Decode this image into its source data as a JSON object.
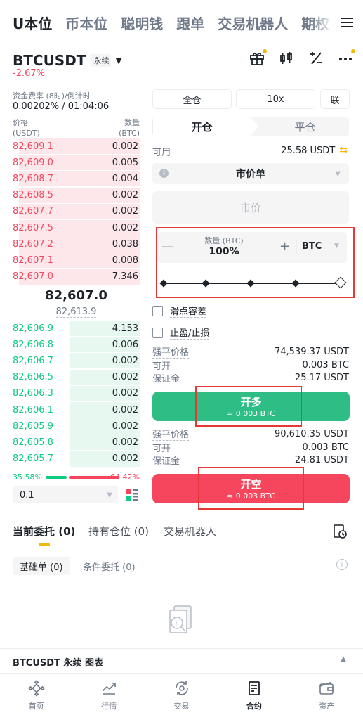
{
  "top_tabs": [
    "U本位",
    "币本位",
    "聪明钱",
    "跟单",
    "交易机器人",
    "期权"
  ],
  "header": {
    "symbol": "BTCUSDT",
    "perp_label": "永续",
    "change": "-2.67%"
  },
  "funding": {
    "label": "资金费率 (8时)/倒计时",
    "value": "0.00202% / 01:04:06"
  },
  "orderbook": {
    "price_label": "价格",
    "price_unit": "(USDT)",
    "qty_label": "数量",
    "qty_unit": "(BTC)",
    "asks": [
      {
        "price": "82,609.1",
        "qty": "0.002",
        "depth": 0.95
      },
      {
        "price": "82,609.0",
        "qty": "0.005",
        "depth": 0.95
      },
      {
        "price": "82,608.7",
        "qty": "0.004",
        "depth": 0.95
      },
      {
        "price": "82,608.5",
        "qty": "0.002",
        "depth": 0.95
      },
      {
        "price": "82,607.7",
        "qty": "0.002",
        "depth": 0.95
      },
      {
        "price": "82,607.5",
        "qty": "0.002",
        "depth": 0.95
      },
      {
        "price": "82,607.2",
        "qty": "0.038",
        "depth": 0.95
      },
      {
        "price": "82,607.1",
        "qty": "0.008",
        "depth": 0.95
      },
      {
        "price": "82,607.0",
        "qty": "7.346",
        "depth": 0.95
      }
    ],
    "last_price": "82,607.0",
    "mark_price": "82,613.9",
    "bids": [
      {
        "price": "82,606.9",
        "qty": "4.153",
        "depth": 0.55
      },
      {
        "price": "82,606.8",
        "qty": "0.006",
        "depth": 0.55
      },
      {
        "price": "82,606.7",
        "qty": "0.002",
        "depth": 0.55
      },
      {
        "price": "82,606.5",
        "qty": "0.002",
        "depth": 0.55
      },
      {
        "price": "82,606.3",
        "qty": "0.002",
        "depth": 0.55
      },
      {
        "price": "82,606.1",
        "qty": "0.002",
        "depth": 0.55
      },
      {
        "price": "82,605.9",
        "qty": "0.002",
        "depth": 0.55
      },
      {
        "price": "82,605.8",
        "qty": "0.002",
        "depth": 0.55
      },
      {
        "price": "82,605.7",
        "qty": "0.002",
        "depth": 0.55
      }
    ],
    "buy_ratio": "35.58%",
    "sell_ratio": "64.42%",
    "depth_value": "0.1"
  },
  "order": {
    "margin_mode": "全仓",
    "leverage": "10x",
    "mode_short": "联",
    "open_tab": "开仓",
    "close_tab": "平仓",
    "available_label": "可用",
    "available_value": "25.58 USDT",
    "order_type": "市价单",
    "price_placeholder": "市价",
    "qty_label": "数量 (BTC)",
    "qty_value": "100%",
    "qty_unit": "BTC",
    "slider_percent": 100,
    "slippage_label": "滑点容差",
    "tpsl_label": "止盈/止损",
    "long": {
      "liq_label": "强平价格",
      "liq_value": "74,539.37 USDT",
      "open_label": "可开",
      "open_value": "0.003 BTC",
      "margin_label": "保证金",
      "margin_value": "25.17 USDT",
      "button": "开多",
      "button_sub": "≈ 0.003 BTC"
    },
    "short": {
      "liq_label": "强平价格",
      "liq_value": "90,610.35 USDT",
      "open_label": "可开",
      "open_value": "0.003 BTC",
      "margin_label": "保证金",
      "margin_value": "24.81 USDT",
      "button": "开空",
      "button_sub": "≈ 0.003 BTC"
    }
  },
  "bottom": {
    "tabs": [
      "当前委托 (0)",
      "持有仓位 (0)",
      "交易机器人"
    ],
    "sub_tabs": [
      "基础单 (0)",
      "条件委托 (0)"
    ],
    "chart_label": "BTCUSDT 永续 图表"
  },
  "nav": [
    "首页",
    "行情",
    "交易",
    "合约",
    "资产"
  ],
  "colors": {
    "green": "#2ebd85",
    "red": "#f6465d",
    "accent": "#f0b90b",
    "highlight": "#e53935"
  }
}
